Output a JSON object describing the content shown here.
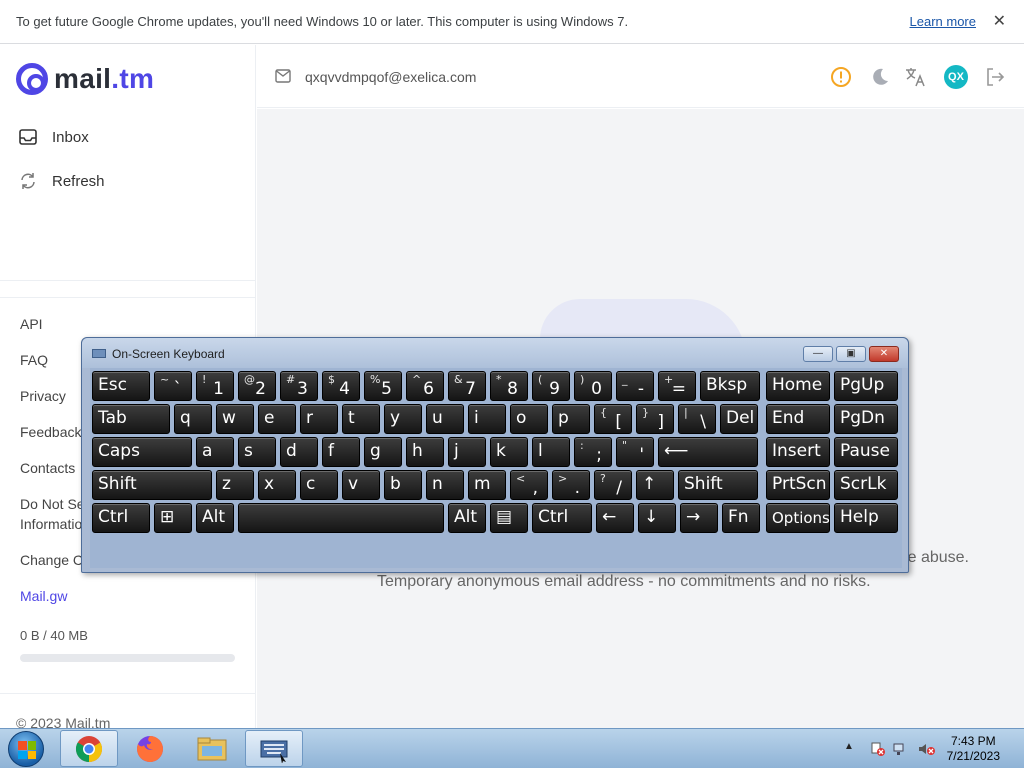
{
  "infobar": {
    "message": "To get future Google Chrome updates, you'll need Windows 10 or later. This computer is using Windows 7.",
    "learn_more": "Learn more",
    "close": "✕"
  },
  "brand": {
    "name": "mail",
    "tld": ".tm"
  },
  "sidebar": {
    "inbox": "Inbox",
    "refresh": "Refresh",
    "links": [
      "API",
      "FAQ",
      "Privacy",
      "Feedback",
      "Contacts",
      "Do Not Se",
      "Informatio",
      "Change C",
      "Mail.gw"
    ],
    "storage": "0 B  / 40 MB",
    "storage_used_fraction": 0,
    "copyright": "© 2023 Mail.tm"
  },
  "header": {
    "email": "qxqvvdmpqof@exelica.com",
    "avatar_initials": "QX",
    "icons": [
      "warning-icon",
      "moon-icon",
      "translate-icon",
      "avatar",
      "logout-icon"
    ]
  },
  "main": {
    "tagline1": "e abuse.",
    "tagline2": "Temporary anonymous email address - no commitments and no risks."
  },
  "osk": {
    "title": "On-Screen Keyboard",
    "rows": [
      [
        {
          "l": "Esc"
        },
        {
          "s": "~",
          "m": "`"
        },
        {
          "s": "!",
          "m": "1"
        },
        {
          "s": "@",
          "m": "2"
        },
        {
          "s": "#",
          "m": "3"
        },
        {
          "s": "$",
          "m": "4"
        },
        {
          "s": "%",
          "m": "5"
        },
        {
          "s": "^",
          "m": "6"
        },
        {
          "s": "&",
          "m": "7"
        },
        {
          "s": "*",
          "m": "8"
        },
        {
          "s": "(",
          "m": "9"
        },
        {
          "s": ")",
          "m": "0"
        },
        {
          "s": "_",
          "m": "-"
        },
        {
          "s": "+",
          "m": "="
        },
        {
          "l": "Bksp"
        },
        {
          "l": "Home"
        },
        {
          "l": "PgUp"
        }
      ],
      [
        {
          "l": "Tab"
        },
        {
          "l": "q"
        },
        {
          "l": "w"
        },
        {
          "l": "e"
        },
        {
          "l": "r"
        },
        {
          "l": "t"
        },
        {
          "l": "y"
        },
        {
          "l": "u"
        },
        {
          "l": "i"
        },
        {
          "l": "o"
        },
        {
          "l": "p"
        },
        {
          "s": "{",
          "m": "["
        },
        {
          "s": "}",
          "m": "]"
        },
        {
          "s": "|",
          "m": "\\"
        },
        {
          "l": "Del"
        },
        {
          "l": "End"
        },
        {
          "l": "PgDn"
        }
      ],
      [
        {
          "l": "Caps"
        },
        {
          "l": "a"
        },
        {
          "l": "s"
        },
        {
          "l": "d"
        },
        {
          "l": "f"
        },
        {
          "l": "g"
        },
        {
          "l": "h"
        },
        {
          "l": "j"
        },
        {
          "l": "k"
        },
        {
          "l": "l"
        },
        {
          "s": ":",
          "m": ";"
        },
        {
          "s": "\"",
          "m": "'"
        },
        {
          "l": "⟵"
        },
        {
          "l": "Insert"
        },
        {
          "l": "Pause"
        }
      ],
      [
        {
          "l": "Shift"
        },
        {
          "l": "z"
        },
        {
          "l": "x"
        },
        {
          "l": "c"
        },
        {
          "l": "v"
        },
        {
          "l": "b"
        },
        {
          "l": "n"
        },
        {
          "l": "m"
        },
        {
          "s": "<",
          "m": ","
        },
        {
          "s": ">",
          "m": "."
        },
        {
          "s": "?",
          "m": "/"
        },
        {
          "l": "↑"
        },
        {
          "l": "Shift"
        },
        {
          "l": "PrtScn"
        },
        {
          "l": "ScrLk"
        }
      ],
      [
        {
          "l": "Ctrl"
        },
        {
          "l": "⊞"
        },
        {
          "l": "Alt"
        },
        {
          "l": ""
        },
        {
          "l": "Alt"
        },
        {
          "l": "▤"
        },
        {
          "l": "Ctrl"
        },
        {
          "l": "←"
        },
        {
          "l": "↓"
        },
        {
          "l": "→"
        },
        {
          "l": "Fn"
        },
        {
          "l": "Options"
        },
        {
          "l": "Help"
        }
      ]
    ]
  },
  "taskbar": {
    "apps": [
      "chrome-icon",
      "firefox-icon",
      "file-explorer-icon",
      "on-screen-keyboard-icon"
    ],
    "time": "7:43 PM",
    "date": "7/21/2023"
  },
  "colors": {
    "accent": "#4f46e5",
    "avatar": "#14b8c4",
    "warning": "#f5a623"
  }
}
